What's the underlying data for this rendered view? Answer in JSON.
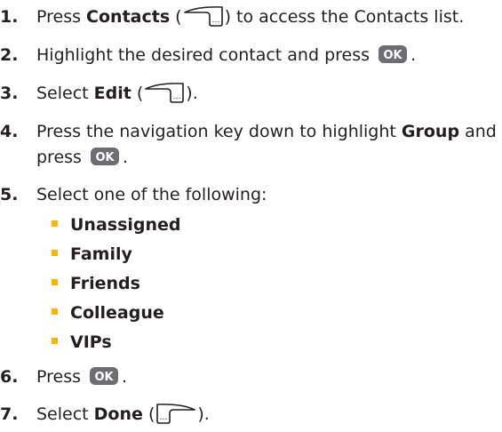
{
  "icons": {
    "right_softkey": "right-softkey-icon",
    "left_softkey": "left-softkey-icon",
    "ok_key": "ok-key-icon"
  },
  "colors": {
    "text": "#231f20",
    "bullet": "#f7b500",
    "ok_key": "#6d6e71"
  },
  "ok_label": "OK",
  "steps": [
    {
      "num": "1.",
      "pre": "Press ",
      "bold": "Contacts",
      "mid": " (",
      "post": ") to access the Contacts list."
    },
    {
      "num": "2.",
      "pre": "Highlight the desired contact and press ",
      "post": "."
    },
    {
      "num": "3.",
      "pre": "Select ",
      "bold": "Edit",
      "mid": " (",
      "post": ")."
    },
    {
      "num": "4.",
      "pre": "Press the navigation key down to highlight ",
      "bold": "Group",
      "post": " and",
      "line2_pre": "press ",
      "line2_post": "."
    },
    {
      "num": "5.",
      "pre": "Select one of the following:"
    },
    {
      "num": "6.",
      "pre": "Press ",
      "post": "."
    },
    {
      "num": "7.",
      "pre": "Select ",
      "bold": "Done",
      "mid": " (",
      "post": ")."
    }
  ],
  "options": [
    "Unassigned",
    "Family",
    "Friends",
    "Colleague",
    "VIPs"
  ]
}
